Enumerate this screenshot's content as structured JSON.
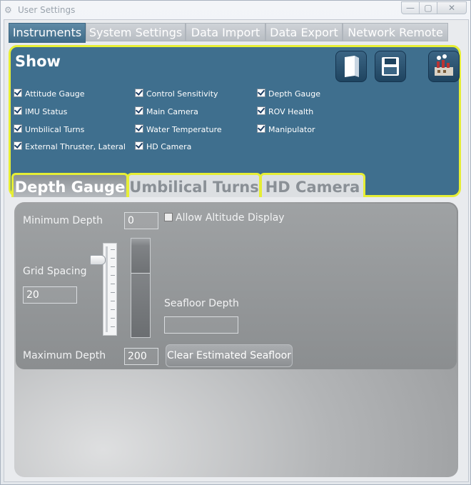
{
  "window": {
    "title": "User Settings",
    "controls": {
      "minimize": "—",
      "maximize": "▢",
      "close": "✕"
    }
  },
  "top_tabs": [
    {
      "label": "Instruments",
      "active": true
    },
    {
      "label": "System Settings",
      "active": false
    },
    {
      "label": "Data Import",
      "active": false
    },
    {
      "label": "Data Export",
      "active": false
    },
    {
      "label": "Network Remote",
      "active": false
    }
  ],
  "show_panel": {
    "title": "Show",
    "toolbar_icons": [
      "open-file-icon",
      "save-icon",
      "factory-icon"
    ],
    "checkboxes": [
      {
        "label": "Attitude Gauge",
        "checked": true
      },
      {
        "label": "IMU Status",
        "checked": true
      },
      {
        "label": "Umbilical Turns",
        "checked": true
      },
      {
        "label": "External Thruster, Lateral",
        "checked": true
      },
      {
        "label": "Control Sensitivity",
        "checked": true
      },
      {
        "label": "Main Camera",
        "checked": true
      },
      {
        "label": "Water Temperature",
        "checked": true
      },
      {
        "label": "HD Camera",
        "checked": true
      },
      {
        "label": "Depth Gauge",
        "checked": true
      },
      {
        "label": "ROV Health",
        "checked": true
      },
      {
        "label": "Manipulator",
        "checked": true
      }
    ]
  },
  "sub_tabs": [
    {
      "label": "Depth Gauge",
      "active": true
    },
    {
      "label": "Umbilical Turns",
      "active": false
    },
    {
      "label": "HD Camera",
      "active": false
    }
  ],
  "depth_gauge": {
    "minimum_depth_label": "Minimum Depth",
    "minimum_depth_value": "0",
    "allow_altitude_label": "Allow Altitude Display",
    "allow_altitude_checked": false,
    "grid_spacing_label": "Grid Spacing",
    "grid_spacing_value": "20",
    "seafloor_depth_label": "Seafloor Depth",
    "seafloor_depth_value": "",
    "maximum_depth_label": "Maximum Depth",
    "maximum_depth_value": "200",
    "clear_button_label": "Clear Estimated Seafloor"
  },
  "colors": {
    "panel_blue": "#3f6f8e",
    "highlight_yellow": "#e6ee35"
  }
}
